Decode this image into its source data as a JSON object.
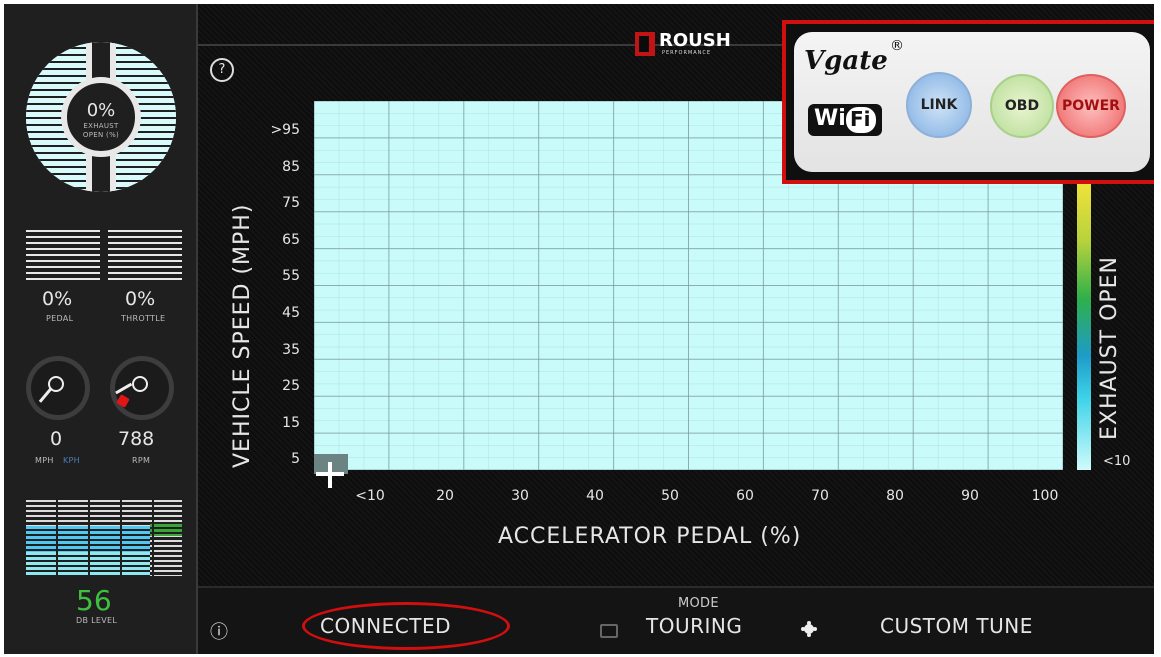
{
  "left_panel": {
    "exhaust_value": "0%",
    "exhaust_label_1": "EXHAUST",
    "exhaust_label_2": "OPEN (%)",
    "pedal_value": "0%",
    "pedal_label": "PEDAL",
    "throttle_value": "0%",
    "throttle_label": "THROTTLE",
    "speed_value": "0",
    "speed_unit_mph": "MPH",
    "speed_unit_kph": "KPH",
    "rpm_value": "788",
    "rpm_label": "RPM",
    "db_value": "56",
    "db_label": "DB LEVEL"
  },
  "header": {
    "help_icon": "?",
    "brand": "ROUSH",
    "brand_sub": "PERFORMANCE"
  },
  "chart": {
    "y_axis_label": "VEHICLE SPEED (MPH)",
    "y_ticks": [
      ">95",
      "85",
      "75",
      "65",
      "55",
      "45",
      "35",
      "25",
      "15",
      "5"
    ],
    "x_axis_label": "ACCELERATOR PEDAL (%)",
    "x_ticks": [
      "<10",
      "20",
      "30",
      "40",
      "50",
      "60",
      "70",
      "80",
      "90",
      "100"
    ],
    "right_axis_label": "EXHAUST OPEN",
    "right_tick": "<10",
    "colors": {
      "grid_bg": "#c9fbfb",
      "grid_line": "#7a9c9c",
      "accent_red": "#d10f0f"
    }
  },
  "vgate": {
    "brand": "Vgate",
    "registered": "®",
    "wifi_1": "Wi",
    "wifi_2": "Fi",
    "led_link": "LINK",
    "led_obd": "OBD",
    "led_power": "POWER"
  },
  "footer": {
    "info_icon": "ⓘ",
    "status": "CONNECTED",
    "mode_label": "MODE",
    "mode_value": "TOURING",
    "tune": "CUSTOM TUNE"
  }
}
